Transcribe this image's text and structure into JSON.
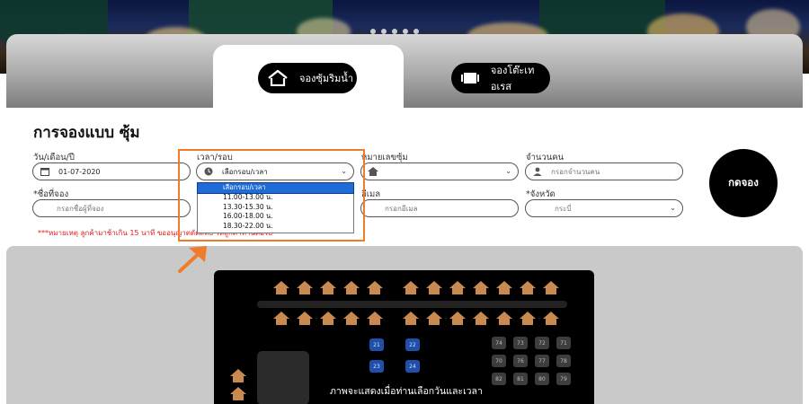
{
  "colors": {
    "accent_orange": "#f07b2a",
    "brand_black": "#000000",
    "note_red": "#e02020",
    "selected_option_blue": "#1f6cd6"
  },
  "slider": {
    "dots": 5
  },
  "tabs": [
    {
      "label": "จองซุ้มริมน้ำ",
      "icon": "house-icon",
      "active": true
    },
    {
      "label": "จองโต๊ะเทอเรส",
      "icon": "table-icon",
      "active": false
    }
  ],
  "form": {
    "title": "การจองแบบ ซุ้ม",
    "date": {
      "label": "วัน/เดือน/ปี",
      "value": "01-07-2020",
      "icon": "calendar-icon"
    },
    "time": {
      "label": "เวลา/รอบ",
      "value": "เลือกรอบ/เวลา",
      "icon": "clock-icon"
    },
    "booth": {
      "label": "หมายเลขซุ้ม",
      "icon": "house-icon"
    },
    "people": {
      "label": "จำนวนคน",
      "placeholder": "กรอกจำนวนคน",
      "icon": "user-icon"
    },
    "name": {
      "label": "*ชื่อที่จอง",
      "placeholder": "กรอกชื่อผู้ที่จอง"
    },
    "email": {
      "label": "อีเมล",
      "placeholder": "กรอกอีเมล"
    },
    "province": {
      "label": "*จังหวัด",
      "value": "กระบี่"
    },
    "note": "***หมายเหตุ ลูกค้ามาช้าเกิน 15 นาที ขออนุญาตตัดสิทธิ์ ให้ลูกค้าท่านต่อไป",
    "submit": "กดจอง"
  },
  "time_options": [
    {
      "label": "เลือกรอบ/เวลา",
      "selected": true
    },
    {
      "label": "11.00-13.00 น.",
      "selected": false
    },
    {
      "label": "13.30-15.30 น.",
      "selected": false
    },
    {
      "label": "16.00-18.00 น.",
      "selected": false
    },
    {
      "label": "18.30-22.00 น.",
      "selected": false
    }
  ],
  "map": {
    "message": "ภาพจะแสดงเมื่อท่านเลือกวันและเวลา",
    "blue_seats": [
      "21",
      "22",
      "23",
      "24"
    ],
    "table_grid": [
      "74",
      "73",
      "72",
      "71",
      "70",
      "76",
      "77",
      "78",
      "82",
      "81",
      "80",
      "79"
    ]
  }
}
